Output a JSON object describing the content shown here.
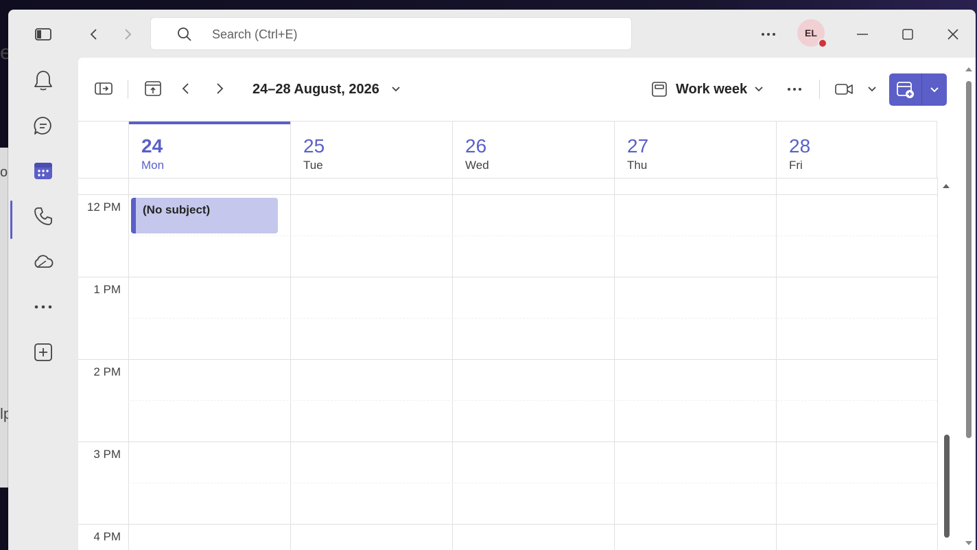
{
  "desktop": {
    "glyph_1": "e",
    "glyph_2": "o",
    "glyph_3": "lp"
  },
  "titlebar": {
    "search_placeholder": "Search (Ctrl+E)",
    "avatar_initials": "EL",
    "presence_color": "#d13438"
  },
  "rail": {
    "items": [
      "activity-icon",
      "chat-icon",
      "calendar-icon",
      "calls-icon",
      "onedrive-icon",
      "more-apps-icon",
      "add-apps-icon"
    ],
    "active": "calendar"
  },
  "toolbar": {
    "date_range": "24–28 August, 2026",
    "view": "Work week"
  },
  "calendar": {
    "days": [
      {
        "num": "24",
        "name": "Mon",
        "today": true
      },
      {
        "num": "25",
        "name": "Tue"
      },
      {
        "num": "26",
        "name": "Wed"
      },
      {
        "num": "27",
        "name": "Thu"
      },
      {
        "num": "28",
        "name": "Fri"
      }
    ],
    "hours": [
      "12 PM",
      "1 PM",
      "2 PM",
      "3 PM",
      "4 PM"
    ],
    "events": [
      {
        "title": "(No subject)",
        "day": "Mon",
        "start": "12 PM"
      }
    ]
  },
  "colors": {
    "accent": "#5b5fc7",
    "event_fill": "#c5c8ec"
  }
}
